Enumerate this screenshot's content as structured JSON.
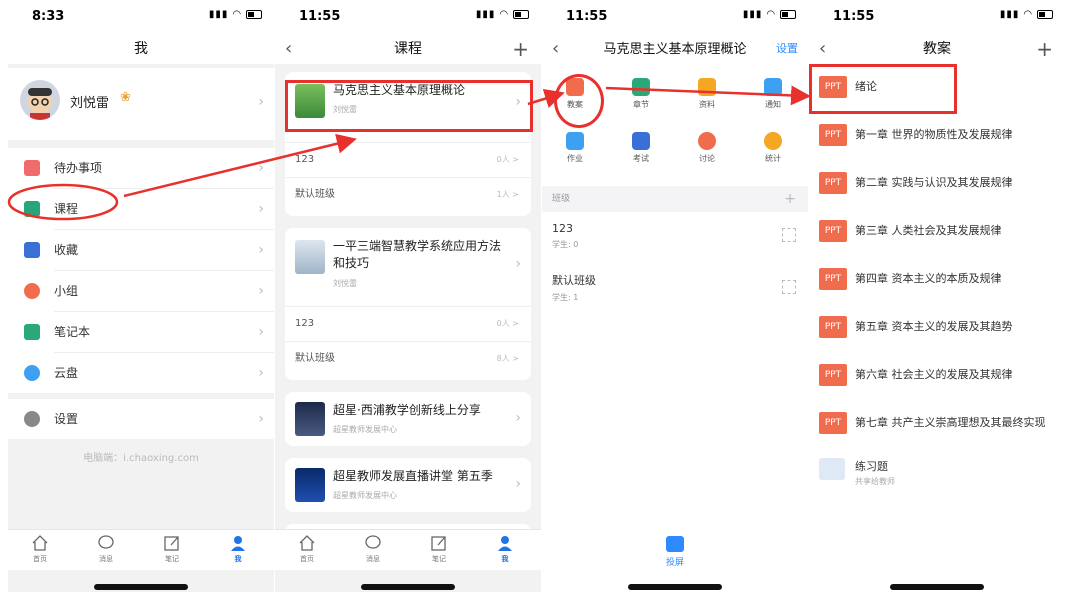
{
  "panel1": {
    "status": {
      "time": "8:33"
    },
    "title": "我",
    "profile": {
      "name": "刘悦雷",
      "badge": "❀"
    },
    "menu": [
      {
        "label": "待办事项",
        "icon": "todo-icon",
        "color": "#f06c6c"
      },
      {
        "label": "课程",
        "icon": "course-hat-icon",
        "color": "#27a57b"
      },
      {
        "label": "收藏",
        "icon": "bookmark-icon",
        "color": "#3b6fd8"
      },
      {
        "label": "小组",
        "icon": "group-icon",
        "color": "#f06c4d"
      },
      {
        "label": "笔记本",
        "icon": "notebook-icon",
        "color": "#2aa87a"
      },
      {
        "label": "云盘",
        "icon": "cloud-icon",
        "color": "#3ea0f0"
      },
      {
        "label": "设置",
        "icon": "gear-icon",
        "color": "#888888"
      }
    ],
    "footer": "电脑端：i.chaoxing.com"
  },
  "tabs": [
    {
      "label": "首页",
      "icon": "home-icon"
    },
    {
      "label": "消息",
      "icon": "message-icon"
    },
    {
      "label": "笔记",
      "icon": "note-edit-icon"
    },
    {
      "label": "我",
      "icon": "user-icon"
    }
  ],
  "panel2": {
    "status": {
      "time": "11:55"
    },
    "title": "课程",
    "courses": [
      {
        "title": "马克思主义基本原理概论",
        "author": "刘悦雷",
        "classes": [
          {
            "name": "123",
            "count": "0人 >"
          },
          {
            "name": "默认班级",
            "count": "1人 >"
          }
        ]
      },
      {
        "title": "一平三端智慧教学系统应用方法和技巧",
        "author": "刘悦雷",
        "classes": [
          {
            "name": "123",
            "count": "0人 >"
          },
          {
            "name": "默认班级",
            "count": "8人 >"
          }
        ]
      },
      {
        "title": "超星·西浦教学创新线上分享",
        "author": "超星教师发展中心"
      },
      {
        "title": "超星教师发展直播讲堂 第五季",
        "author": "超星教师发展中心"
      }
    ]
  },
  "panel3": {
    "status": {
      "time": "11:55"
    },
    "title": "马克思主义基本原理概论",
    "settings": "设置",
    "grid": [
      {
        "label": "教案",
        "icon": "lesson-plan-icon",
        "color": "#f06c4d"
      },
      {
        "label": "章节",
        "icon": "chapter-icon",
        "color": "#2aa87a"
      },
      {
        "label": "资料",
        "icon": "folder-icon",
        "color": "#f5a623"
      },
      {
        "label": "通知",
        "icon": "notice-icon",
        "color": "#3ea0f0"
      },
      {
        "label": "作业",
        "icon": "homework-icon",
        "color": "#3ea0f0"
      },
      {
        "label": "考试",
        "icon": "exam-icon",
        "color": "#3b6fd8"
      },
      {
        "label": "讨论",
        "icon": "discussion-icon",
        "color": "#f06c4d"
      },
      {
        "label": "统计",
        "icon": "stats-icon",
        "color": "#f5a623"
      }
    ],
    "section": "班级",
    "classes": [
      {
        "name": "123",
        "students": "学生: 0"
      },
      {
        "name": "默认班级",
        "students": "学生: 1"
      }
    ],
    "cast": "投屏"
  },
  "panel4": {
    "status": {
      "time": "11:55"
    },
    "title": "教案",
    "badge": "PPT",
    "items": [
      "绪论",
      "第一章 世界的物质性及发展规律",
      "第二章 实践与认识及其发展规律",
      "第三章 人类社会及其发展规律",
      "第四章 资本主义的本质及规律",
      "第五章 资本主义的发展及其趋势",
      "第六章 社会主义的发展及其规律",
      "第七章 共产主义崇高理想及其最终实现"
    ],
    "folder": {
      "title": "练习题",
      "sub": "共享给教师"
    }
  },
  "colors": {
    "annotation": "#e8312c",
    "accent": "#2e8bff"
  }
}
